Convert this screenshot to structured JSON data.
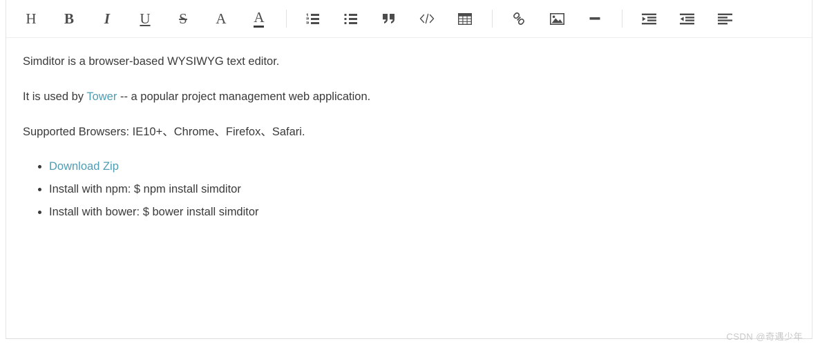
{
  "toolbar": {
    "groups": [
      {
        "name": "format-group",
        "items": [
          {
            "name": "title-button",
            "icon": "heading-icon",
            "label": "H",
            "title": "Title"
          },
          {
            "name": "bold-button",
            "icon": "bold-icon",
            "label": "B",
            "title": "Bold"
          },
          {
            "name": "italic-button",
            "icon": "italic-icon",
            "label": "I",
            "title": "Italic"
          },
          {
            "name": "underline-button",
            "icon": "underline-icon",
            "label": "U",
            "title": "Underline"
          },
          {
            "name": "strikethrough-button",
            "icon": "strikethrough-icon",
            "label": "S",
            "title": "Strikethrough"
          },
          {
            "name": "font-scale-button",
            "icon": "font-size-icon",
            "label": "A",
            "title": "Font Size"
          },
          {
            "name": "font-color-button",
            "icon": "font-color-icon",
            "label": "A",
            "title": "Text Color"
          }
        ]
      },
      {
        "name": "block-group",
        "items": [
          {
            "name": "ordered-list-button",
            "icon": "ordered-list-icon",
            "label": "",
            "title": "Ordered List"
          },
          {
            "name": "unordered-list-button",
            "icon": "unordered-list-icon",
            "label": "",
            "title": "Unordered List"
          },
          {
            "name": "blockquote-button",
            "icon": "blockquote-icon",
            "label": "",
            "title": "Blockquote"
          },
          {
            "name": "code-button",
            "icon": "code-icon",
            "label": "",
            "title": "Code"
          },
          {
            "name": "table-button",
            "icon": "table-icon",
            "label": "",
            "title": "Table"
          }
        ]
      },
      {
        "name": "insert-group",
        "items": [
          {
            "name": "link-button",
            "icon": "link-icon",
            "label": "",
            "title": "Link"
          },
          {
            "name": "image-button",
            "icon": "image-icon",
            "label": "",
            "title": "Image"
          },
          {
            "name": "hr-button",
            "icon": "hr-icon",
            "label": "",
            "title": "Horizontal Rule"
          }
        ]
      },
      {
        "name": "indent-group",
        "items": [
          {
            "name": "indent-button",
            "icon": "indent-icon",
            "label": "",
            "title": "Indent"
          },
          {
            "name": "outdent-button",
            "icon": "outdent-icon",
            "label": "",
            "title": "Outdent"
          },
          {
            "name": "align-left-button",
            "icon": "align-left-icon",
            "label": "",
            "title": "Align Left"
          }
        ]
      }
    ]
  },
  "content": {
    "paragraph_1": "Simditor is a browser-based WYSIWYG text editor.",
    "paragraph_2": {
      "before": "It is used by ",
      "link_text": "Tower",
      "after": " -- a popular project management web application."
    },
    "paragraph_3": "Supported Browsers: IE10+、Chrome、Firefox、Safari.",
    "list_items": [
      {
        "text": "Download Zip",
        "is_link": true
      },
      {
        "text": "Install with npm: $ npm install simditor",
        "is_link": false
      },
      {
        "text": "Install with bower: $ bower install simditor",
        "is_link": false
      }
    ]
  },
  "watermark": {
    "text": "CSDN @奇遇少年"
  },
  "colors": {
    "link": "#4e9db3",
    "text": "#3a3a3a",
    "icon": "#4c4c4c",
    "border": "#e3e3e3",
    "toolbar_divider": "#eeeeee",
    "watermark": "#c8c8c8"
  }
}
